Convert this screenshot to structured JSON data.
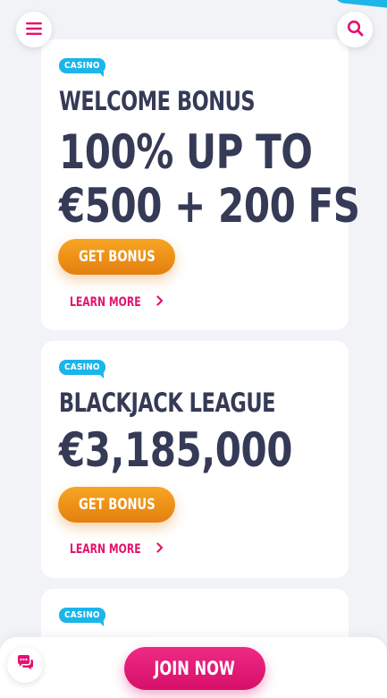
{
  "header": {
    "menu_icon": "hamburger-menu-icon",
    "search_icon": "search-icon",
    "accent_color": "#e3136f"
  },
  "cards": [
    {
      "badge": "CASINO",
      "title": "WELCOME BONUS",
      "amount_line1": "100% UP TO",
      "amount_line2": "€500 + 200 FS",
      "button": "GET BONUS",
      "link": "LEARN MORE"
    },
    {
      "badge": "CASINO",
      "title": "BLACKJACK LEAGUE",
      "amount_line1": "€3,185,000",
      "button": "GET BONUS",
      "link": "LEARN MORE"
    },
    {
      "badge": "CASINO"
    }
  ],
  "footer": {
    "join_label": "JOIN NOW",
    "chat_icon": "chat-icon"
  },
  "colors": {
    "badge": "#1cb5e9",
    "bonus_button": "#f0961b",
    "join_button": "#e3136f",
    "text": "#353a56",
    "background": "#f2f3f7"
  }
}
